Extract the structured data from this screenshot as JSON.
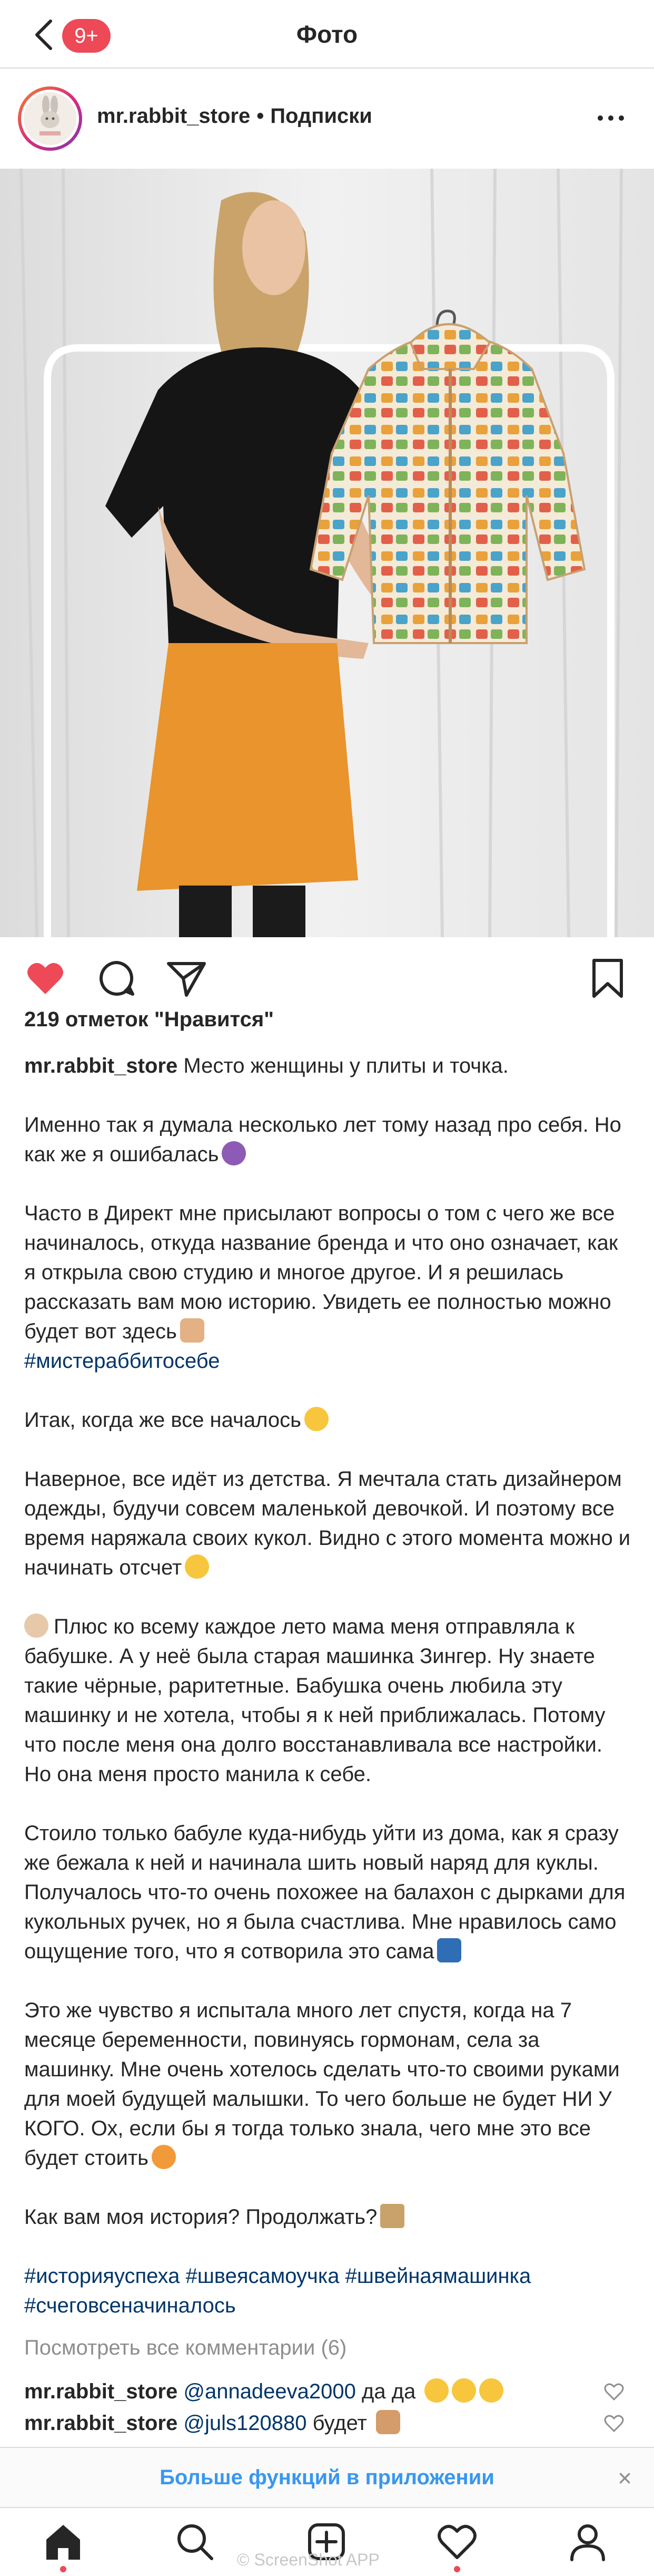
{
  "topbar": {
    "title": "Фото",
    "badge": "9+"
  },
  "post": {
    "username": "mr.rabbit_store",
    "separator": "•",
    "follow_label": "Подписки",
    "likes_text": "219 отметок \"Нравится\"",
    "caption": {
      "user": "mr.rabbit_store",
      "first_line": "Место женщины у плиты и точка.",
      "p2": "Именно так я думала несколько лет тому назад про себя. Но как же я ошибалась",
      "p3": "Часто в Директ мне присылают вопросы о том с чего же все начиналось, откуда название бренда и что оно означает, как я открыла свою студию и многое другое. И я решилась рассказать вам мою историю. Увидеть ее полностью можно будет вот здесь",
      "p3_tag": "#мистераббитосебе",
      "p4": "Итак, когда же все началось",
      "p5": "Наверное, все идёт из детства. Я мечтала стать дизайнером одежды, будучи совсем маленькой девочкой. И поэтому все время наряжала своих кукол. Видно с этого момента можно и начинать отсчет",
      "p6": "Плюс ко всему каждое лето мама меня отправляла к бабушке. А у неё была старая машинка Зингер. Ну знаете такие чёрные, раритетные. Бабушка очень любила эту машинку и не хотела, чтобы я к ней приближалась. Потому что после меня она долго восстанавливала все настройки. Но она меня просто манила к себе.",
      "p7": "Стоило только бабуле куда-нибудь уйти из дома, как я сразу же бежала к ней и начинала шить новый наряд для куклы. Получалось что-то очень похожее на балахон с дырками для кукольных ручек, но я была счастлива. Мне нравилось само ощущение того, что я сотворила это сама",
      "p8": "Это же чувство я испытала много лет спустя, когда на 7 месяце беременности, повинуясь гормонам, села за машинку. Мне очень хотелось сделать что-то своими руками для моей будущей малышки. То чего больше не будет НИ У КОГО. Ох, если бы я тогда только знала, чего мне это все будет стоить",
      "p9": "Как вам моя история? Продолжать?",
      "hashtags_line1": "#историяуспеха #швеясамоучка #швейнаямашинка",
      "hashtags_line2": "#счеговсеначиналось"
    },
    "view_comments": "Посмотреть все комментарии (6)",
    "comments": [
      {
        "user": "mr.rabbit_store",
        "mention": "@annadeeva2000",
        "text": "да да"
      },
      {
        "user": "mr.rabbit_store",
        "mention": "@juls120880",
        "text": "будет"
      }
    ]
  },
  "banner": {
    "text": "Больше функций в приложении",
    "close": "×"
  },
  "watermark": "© ScreenShot APP",
  "icons": {
    "back": "chevron-left-icon",
    "more": "more-dots-icon",
    "like": "heart-filled-icon",
    "comment": "comment-bubble-icon",
    "share": "paper-plane-icon",
    "save": "bookmark-icon",
    "home": "home-icon",
    "search": "search-icon",
    "add": "add-post-icon",
    "activity": "heart-outline-icon",
    "profile": "profile-icon"
  },
  "colors": {
    "like_red": "#ed4956",
    "link_blue": "#3897f0",
    "hashtag": "#003569",
    "muted": "#8e8e8e"
  }
}
